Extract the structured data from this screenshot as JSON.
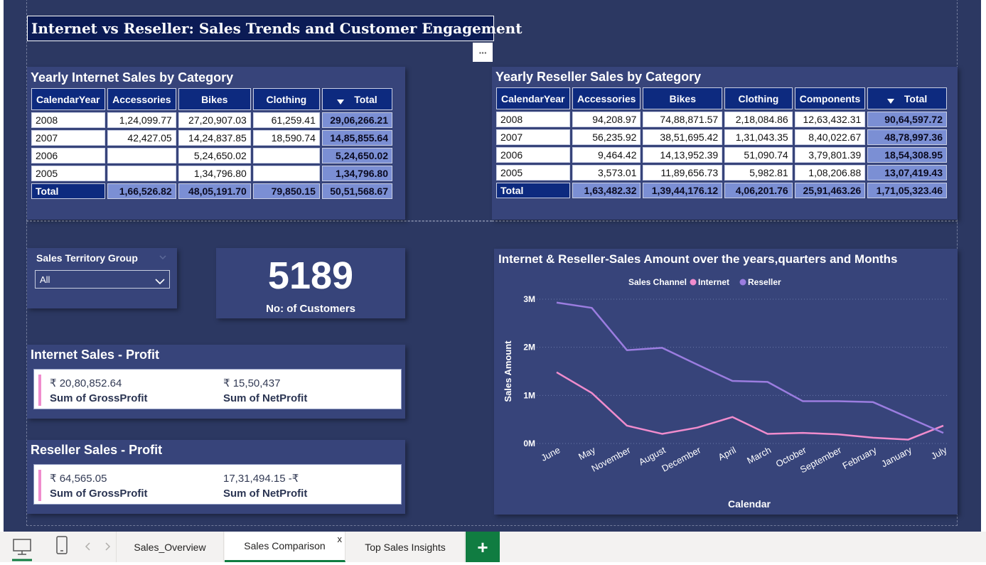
{
  "report_title": "Internet vs Reseller: Sales Trends and Customer Engagement",
  "more_options_label": "···",
  "internet_table": {
    "title": "Yearly Internet Sales by Category",
    "headers": [
      "CalendarYear",
      "Accessories",
      "Bikes",
      "Clothing",
      "Total"
    ],
    "rows": [
      [
        "2008",
        "1,24,099.77",
        "27,20,907.03",
        "61,259.41",
        "29,06,266.21"
      ],
      [
        "2007",
        "42,427.05",
        "14,24,837.85",
        "18,590.74",
        "14,85,855.64"
      ],
      [
        "2006",
        "",
        "5,24,650.02",
        "",
        "5,24,650.02"
      ],
      [
        "2005",
        "",
        "1,34,796.80",
        "",
        "1,34,796.80"
      ]
    ],
    "total_row": [
      "Total",
      "1,66,526.82",
      "48,05,191.70",
      "79,850.15",
      "50,51,568.67"
    ]
  },
  "reseller_table": {
    "title": "Yearly Reseller Sales by Category",
    "headers": [
      "CalendarYear",
      "Accessories",
      "Bikes",
      "Clothing",
      "Components",
      "Total"
    ],
    "rows": [
      [
        "2008",
        "94,208.97",
        "74,88,871.57",
        "2,18,084.86",
        "12,63,432.31",
        "90,64,597.72"
      ],
      [
        "2007",
        "56,235.92",
        "38,51,695.42",
        "1,31,043.35",
        "8,40,022.67",
        "48,78,997.36"
      ],
      [
        "2006",
        "9,464.42",
        "14,13,952.39",
        "51,090.74",
        "3,79,801.39",
        "18,54,308.95"
      ],
      [
        "2005",
        "3,573.01",
        "11,89,656.73",
        "5,982.81",
        "1,08,206.88",
        "13,07,419.43"
      ]
    ],
    "total_row": [
      "Total",
      "1,63,482.32",
      "1,39,44,176.12",
      "4,06,201.76",
      "25,91,463.26",
      "1,71,05,323.46"
    ]
  },
  "slicer": {
    "label": "Sales Territory Group",
    "selected": "All"
  },
  "kpi": {
    "value": "5189",
    "label": "No: of Customers"
  },
  "internet_profit": {
    "title": "Internet Sales - Profit",
    "gross_value": "₹ 20,80,852.64",
    "gross_label": "Sum of GrossProfit",
    "net_value": "₹ 15,50,437",
    "net_label": "Sum of NetProfit"
  },
  "reseller_profit": {
    "title": "Reseller Sales - Profit",
    "gross_value": "₹ 64,565.05",
    "gross_label": "Sum of GrossProfit",
    "net_value": "17,31,494.15 -₹",
    "net_label": "Sum of NetProfit"
  },
  "chart_data": {
    "type": "line",
    "title": "Internet & Reseller-Sales Amount over the years,quarters and Months",
    "legend_title": "Sales Channel",
    "legend_placement": "top-center",
    "xlabel": "Calendar",
    "ylabel": "Sales Amount",
    "ylim": [
      0,
      3000000
    ],
    "y_ticks": [
      0,
      1000000,
      2000000,
      3000000
    ],
    "y_tick_labels": [
      "0M",
      "1M",
      "2M",
      "3M"
    ],
    "grid": true,
    "categories": [
      "June",
      "May",
      "November",
      "August",
      "December",
      "April",
      "March",
      "October",
      "September",
      "February",
      "January",
      "July"
    ],
    "series": [
      {
        "name": "Internet",
        "color": "#f08ccd",
        "values": [
          1480000,
          1050000,
          370000,
          200000,
          330000,
          550000,
          200000,
          220000,
          190000,
          120000,
          80000,
          370000
        ]
      },
      {
        "name": "Reseller",
        "color": "#9b7de0",
        "values": [
          2930000,
          2820000,
          1940000,
          1990000,
          1640000,
          1300000,
          1280000,
          880000,
          880000,
          860000,
          540000,
          220000
        ]
      }
    ]
  },
  "tabs": {
    "items": [
      "Sales_Overview",
      "Sales Comparison",
      "Top Sales Insights"
    ],
    "active": "Sales Comparison",
    "close_glyph": "x",
    "add_glyph": "+"
  },
  "colors": {
    "background": "#2c3862",
    "panel": "#37447a",
    "header": "#0d2a7f",
    "total_cell": "#7b8fd4",
    "internet": "#f08ccd",
    "reseller": "#9b7de0",
    "active_tab_underline": "#107c41",
    "add_tab": "#107c41"
  }
}
